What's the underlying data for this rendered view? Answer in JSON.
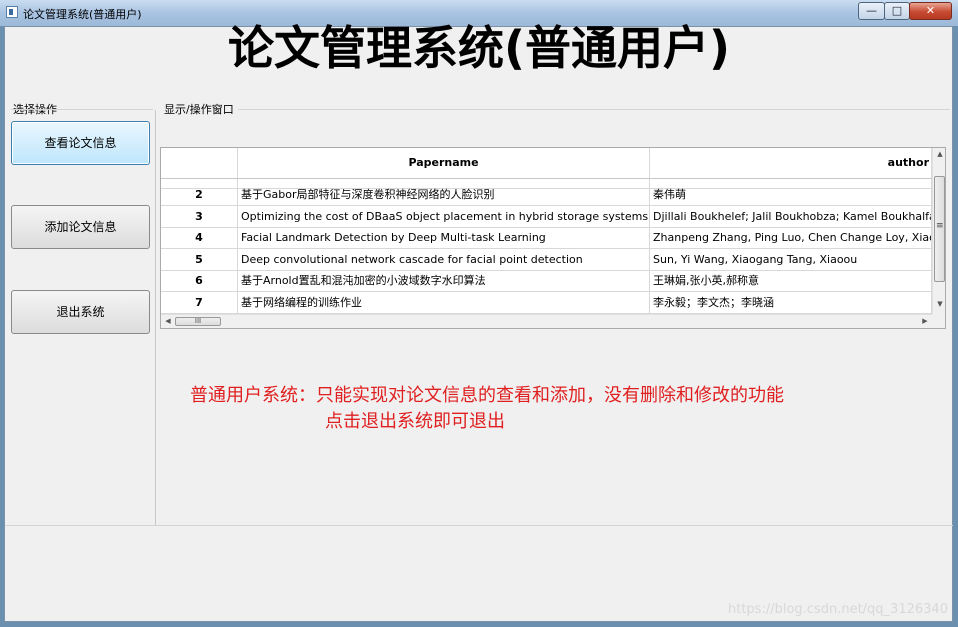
{
  "window": {
    "title": "论文管理系统(普通用户)",
    "min_glyph": "—",
    "max_glyph": "□",
    "close_glyph": "✕"
  },
  "app_title": "论文管理系统(普通用户)",
  "sidebar": {
    "label": "选择操作",
    "buttons": [
      {
        "label": "查看论文信息"
      },
      {
        "label": "添加论文信息"
      },
      {
        "label": "退出系统"
      }
    ]
  },
  "display": {
    "label": "显示/操作窗口",
    "table": {
      "columns": [
        "",
        "Papername",
        "author"
      ],
      "rows": [
        {
          "num": "2",
          "papername": "基于Gabor局部特征与深度卷积神经网络的人脸识别",
          "author": "秦伟萌"
        },
        {
          "num": "3",
          "papername": "Optimizing the cost of DBaaS object placement in hybrid storage systems",
          "author": "Djillali Boukhelef; Jalil Boukhobza; Kamel Boukhalfa"
        },
        {
          "num": "4",
          "papername": "Facial Landmark Detection by Deep Multi-task Learning",
          "author": "Zhanpeng Zhang, Ping Luo, Chen Change Loy, Xiaoou"
        },
        {
          "num": "5",
          "papername": "Deep convolutional network cascade for facial point detection",
          "author": "Sun, Yi  Wang, Xiaogang   Tang, Xiaoou"
        },
        {
          "num": "6",
          "papername": "基于Arnold置乱和混沌加密的小波域数字水印算法",
          "author": "王琳娟,张小英,郝称意"
        },
        {
          "num": "7",
          "papername": "基于网络编程的训练作业",
          "author": "李永毅；李文杰；李晓涵"
        }
      ]
    },
    "scrollbar": {
      "up": "▲",
      "down": "▼",
      "left": "◀",
      "right": "▶",
      "grip": "III",
      "vgrip": "≡"
    },
    "notice": {
      "line1": "普通用户系统：只能实现对论文信息的查看和添加，没有删除和修改的功能",
      "line2": "点击退出系统即可退出"
    }
  },
  "watermark": "https://blog.csdn.net/qq_3126340"
}
